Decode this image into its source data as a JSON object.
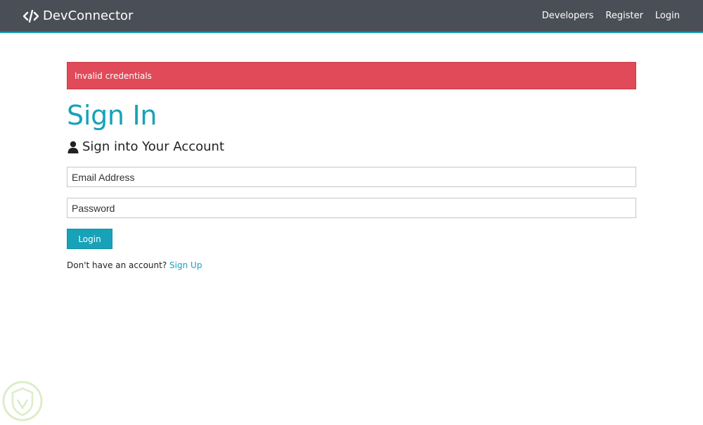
{
  "navbar": {
    "brand": "DevConnector",
    "brand_icon": "code-icon",
    "links": [
      "Developers",
      "Register",
      "Login"
    ],
    "background": "#4a4e56",
    "accent": "#17a2b8"
  },
  "alert": {
    "message": "Invalid credentials",
    "color": "#e04a59"
  },
  "main": {
    "title": "Sign In",
    "lead": "Sign into Your Account",
    "lead_icon": "user-icon"
  },
  "form": {
    "email_placeholder": "Email Address",
    "email_value": "",
    "password_placeholder": "Password",
    "password_value": "",
    "submit_label": "Login"
  },
  "footer_prompt": {
    "text": "Don't have an account?",
    "link": "Sign Up"
  },
  "watermark_icon": "shield-logo-icon"
}
